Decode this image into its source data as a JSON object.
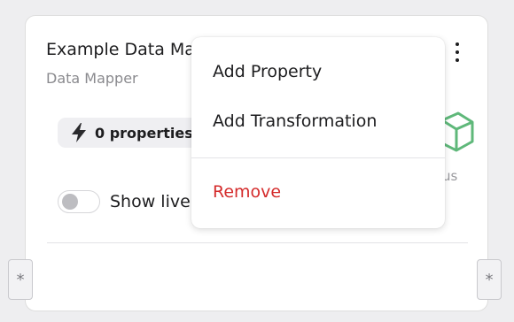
{
  "card": {
    "title": "Example Data Ma",
    "subtitle": "Data Mapper",
    "properties_chip": {
      "label": "0 properties",
      "icon": "lightning-bolt-icon"
    },
    "status": {
      "icon": "cube-icon",
      "text": "us",
      "color": "#5fb87a"
    },
    "live_toggle": {
      "label": "Show live",
      "on": false
    },
    "ports": {
      "left_symbol": "*",
      "right_symbol": "*"
    }
  },
  "context_menu": {
    "items": [
      {
        "label": "Add Property"
      },
      {
        "label": "Add Transformation"
      },
      {
        "label": "Remove",
        "color": "#d42b2b"
      }
    ]
  }
}
